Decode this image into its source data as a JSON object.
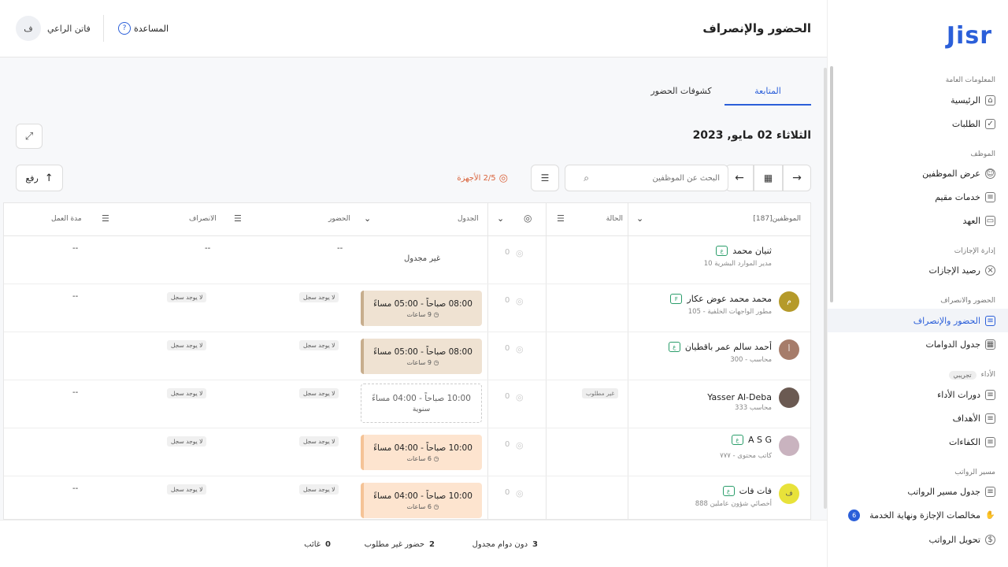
{
  "brand": {
    "logo": "Jisr"
  },
  "sidebar": {
    "sections": [
      {
        "label": "المعلومات العامة"
      },
      {
        "label": "الموظف"
      },
      {
        "label": "إدارة الإجازات"
      },
      {
        "label": "الحضور والانصراف"
      },
      {
        "label": "الأداء",
        "tag": "تجريبي"
      },
      {
        "label": "مسير الرواتب"
      }
    ],
    "items": [
      {
        "label": "الرئيسية"
      },
      {
        "label": "الطلبات"
      },
      {
        "label": "عرض الموظفين"
      },
      {
        "label": "خدمات مقيم"
      },
      {
        "label": "العهد"
      },
      {
        "label": "رصيد الإجازات"
      },
      {
        "label": "الحضور والإنصراف"
      },
      {
        "label": "جدول الدوامات"
      },
      {
        "label": "دورات الأداء"
      },
      {
        "label": "الأهداف"
      },
      {
        "label": "الكفاءات"
      },
      {
        "label": "جدول مسير الرواتب"
      },
      {
        "label": "مخالصات الإجازة ونهاية الخدمة",
        "badge": "6"
      },
      {
        "label": "تحويل الرواتب"
      }
    ]
  },
  "header": {
    "title": "الحضور والإنصراف",
    "help": "المساعدة",
    "user_name": "فاتن الراعي",
    "user_initial": "ف"
  },
  "tabs": [
    {
      "label": "المتابعة"
    },
    {
      "label": "كشوفات الحضور"
    }
  ],
  "date": "الثلاثاء 02 مايو, 2023",
  "toolbar": {
    "search_placeholder": "البحث عن الموظفين",
    "devices": "2/5 الأجهزة",
    "upload": "رفع"
  },
  "table": {
    "headers": {
      "employees": "الموظفين[187]",
      "status": "الحالة",
      "schedule": "الجدول",
      "attendance": "الحضور",
      "departure": "الانصراف",
      "work_duration": "مدة العمل"
    },
    "rows": [
      {
        "name": "ثنيان محمد",
        "badge": "ع",
        "sub": "مدير الموارد البشرية  10",
        "initial": "",
        "fp": "0",
        "schedule_type": "none",
        "schedule": "غير مجدول",
        "hours": "",
        "attend": "--",
        "depart": "--",
        "duration": "--",
        "status": ""
      },
      {
        "name": "محمد محمد عوض عكار",
        "badge": "F",
        "sub": "مطور الواجهات الخلفية - 105",
        "initial": "م",
        "fp": "0",
        "schedule_type": "brown",
        "schedule": "08:00 صباحاً - 05:00 مساءً",
        "hours": "9 ساعات",
        "attend": "لا يوجد سجل",
        "depart": "لا يوجد سجل",
        "duration": "--",
        "status": ""
      },
      {
        "name": "أحمد سالم عمر باقطيان",
        "badge": "ع",
        "sub": "محاسب - 300",
        "initial": "أ",
        "fp": "0",
        "schedule_type": "brown",
        "schedule": "08:00 صباحاً - 05:00 مساءً",
        "hours": "9 ساعات",
        "attend": "لا يوجد سجل",
        "depart": "لا يوجد سجل",
        "duration": "",
        "status": ""
      },
      {
        "name": "Yasser Al-Deba",
        "badge": "",
        "sub": "محاسب  333",
        "initial": "",
        "fp": "0",
        "schedule_type": "dashed",
        "schedule": "10:00 صباحاً - 04:00 مساءً",
        "hours": "سنوية",
        "attend": "لا يوجد سجل",
        "depart": "لا يوجد سجل",
        "duration": "--",
        "status": "غير مطلوب"
      },
      {
        "name": "A S G",
        "badge": "ع",
        "sub": "كاتب محتوى - ٧٧٧",
        "initial": "",
        "fp": "0",
        "schedule_type": "peach",
        "schedule": "10:00 صباحاً - 04:00 مساءً",
        "hours": "6 ساعات",
        "attend": "لا يوجد سجل",
        "depart": "لا يوجد سجل",
        "duration": "",
        "status": ""
      },
      {
        "name": "فات فات",
        "badge": "ع",
        "sub": "أخصائي شؤون عاملين  888",
        "initial": "ف",
        "fp": "0",
        "schedule_type": "peach",
        "schedule": "10:00 صباحاً - 04:00 مساءً",
        "hours": "6 ساعات",
        "attend": "لا يوجد سجل",
        "depart": "لا يوجد سجل",
        "duration": "--",
        "status": ""
      }
    ]
  },
  "footer": {
    "stats": [
      {
        "value": "3",
        "label": "دون دوام مجدول"
      },
      {
        "value": "2",
        "label": "حضور غير مطلوب"
      },
      {
        "value": "0",
        "label": "غائب"
      }
    ]
  },
  "colors": {
    "accent": "#2b5fd9",
    "brown": "#efe2d2",
    "peach": "#fde4cf",
    "device": "#d9623a"
  }
}
